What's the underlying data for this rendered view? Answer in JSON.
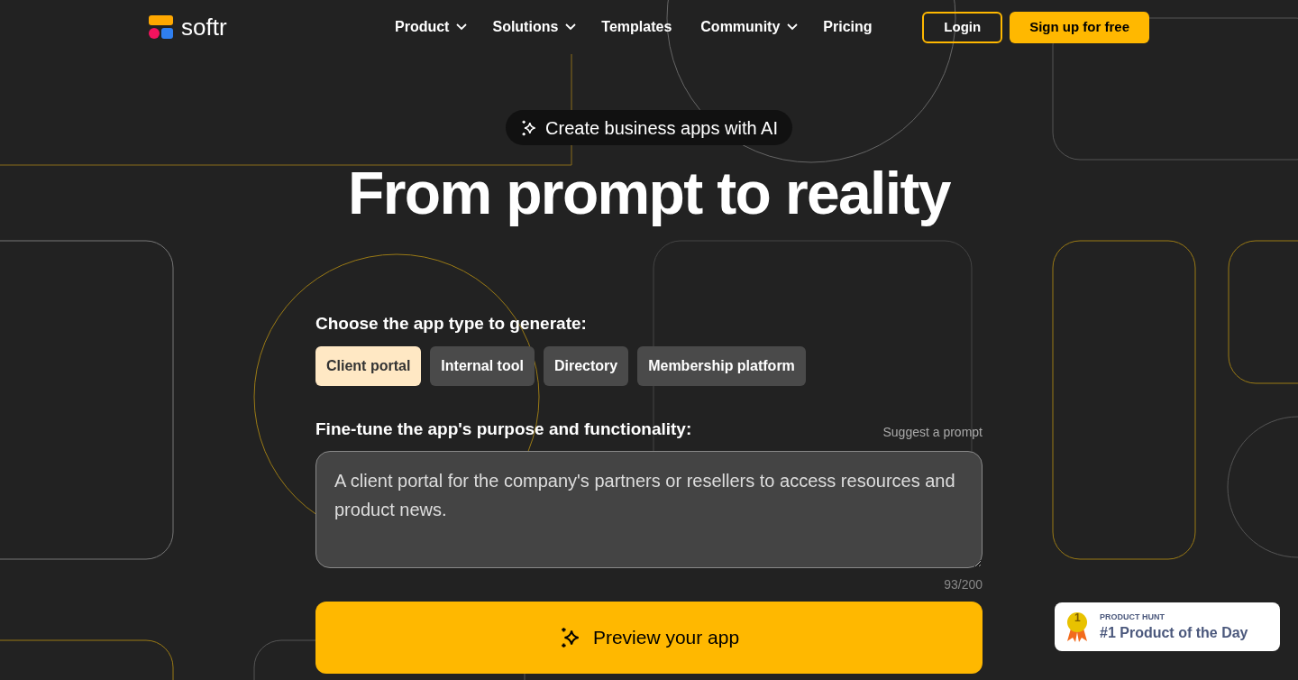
{
  "logo": {
    "wordmark": "softr"
  },
  "nav": [
    {
      "label": "Product",
      "dropdown": true
    },
    {
      "label": "Solutions",
      "dropdown": true
    },
    {
      "label": "Templates",
      "dropdown": false
    },
    {
      "label": "Community",
      "dropdown": true
    },
    {
      "label": "Pricing",
      "dropdown": false
    }
  ],
  "auth": {
    "login": "Login",
    "signup": "Sign up for free"
  },
  "hero": {
    "badge": "Create business apps with AI",
    "title": "From prompt to reality"
  },
  "app_type": {
    "label": "Choose the app type to generate:",
    "options": [
      {
        "label": "Client portal",
        "selected": true
      },
      {
        "label": "Internal tool",
        "selected": false
      },
      {
        "label": "Directory",
        "selected": false
      },
      {
        "label": "Membership platform",
        "selected": false
      }
    ]
  },
  "purpose": {
    "label": "Fine-tune the app's purpose and functionality:",
    "suggest": "Suggest a prompt",
    "value": "A client portal for the company's partners or resellers to access resources and product news.",
    "counter": "93/200"
  },
  "cta": "Preview your app",
  "product_hunt": {
    "kicker": "PRODUCT HUNT",
    "title": "#1 Product of the Day",
    "medal": "1"
  }
}
